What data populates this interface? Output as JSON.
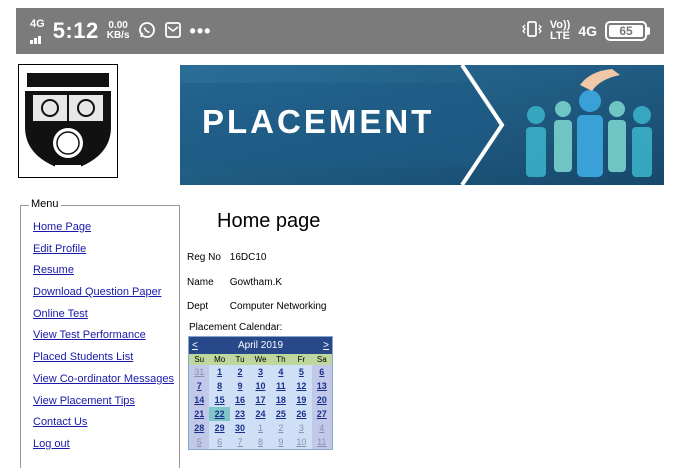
{
  "statusbar": {
    "network": "4G",
    "time": "5:12",
    "speed_value": "0.00",
    "speed_unit": "KB/s",
    "more": "•••",
    "volte_top": "Vo))",
    "volte_bottom": "LTE",
    "network2": "4G",
    "battery": "65"
  },
  "banner": {
    "title": "PLACEMENT"
  },
  "menu": {
    "legend": "Menu",
    "items": [
      {
        "label": "Home Page"
      },
      {
        "label": "Edit Profile"
      },
      {
        "label": "Resume"
      },
      {
        "label": "Download Question Paper"
      },
      {
        "label": "Online Test"
      },
      {
        "label": "View Test Performance"
      },
      {
        "label": "Placed Students List"
      },
      {
        "label": "View Co-ordinator Messages"
      },
      {
        "label": "View Placement Tips"
      },
      {
        "label": "Contact Us"
      },
      {
        "label": "Log out"
      }
    ]
  },
  "main": {
    "title": "Home page",
    "reg_label": "Reg No",
    "reg_value": "16DC10",
    "name_label": "Name",
    "name_value": "Gowtham.K",
    "dept_label": "Dept",
    "dept_value": "Computer Networking",
    "calendar_label": "Placement Calendar:"
  },
  "calendar": {
    "prev": "<",
    "next": ">",
    "month": "April 2019",
    "dow": [
      "Su",
      "Mo",
      "Tu",
      "We",
      "Th",
      "Fr",
      "Sa"
    ],
    "weeks": [
      [
        "31",
        "1",
        "2",
        "3",
        "4",
        "5",
        "6"
      ],
      [
        "7",
        "8",
        "9",
        "10",
        "11",
        "12",
        "13"
      ],
      [
        "14",
        "15",
        "16",
        "17",
        "18",
        "19",
        "20"
      ],
      [
        "21",
        "22",
        "23",
        "24",
        "25",
        "26",
        "27"
      ],
      [
        "28",
        "29",
        "30",
        "1",
        "2",
        "3",
        "4"
      ],
      [
        "5",
        "6",
        "7",
        "8",
        "9",
        "10",
        "11"
      ]
    ],
    "today": "22"
  },
  "colors": {
    "banner": "#2a6a93",
    "calendar_header": "#27498a",
    "link": "#1a1aa8"
  }
}
